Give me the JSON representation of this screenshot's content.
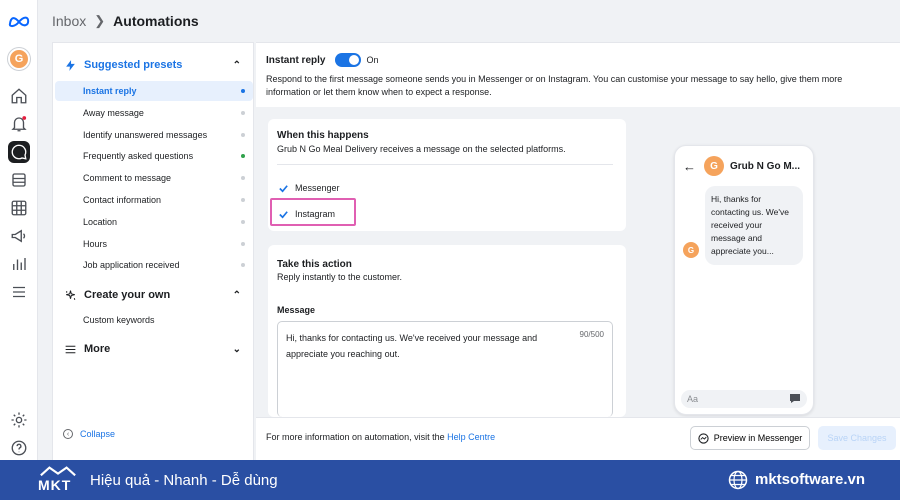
{
  "breadcrumb": {
    "parent": "Inbox",
    "current": "Automations"
  },
  "rail": {
    "avatar_letter": "G"
  },
  "sidebar": {
    "suggested_title": "Suggested presets",
    "suggested_items": [
      {
        "label": "Instant reply",
        "selected": true,
        "status": "blue"
      },
      {
        "label": "Away message",
        "status": "grey"
      },
      {
        "label": "Identify unanswered messages",
        "status": "grey"
      },
      {
        "label": "Frequently asked questions",
        "status": "green"
      },
      {
        "label": "Comment to message",
        "status": "grey"
      },
      {
        "label": "Contact information",
        "status": "grey"
      },
      {
        "label": "Location",
        "status": "grey"
      },
      {
        "label": "Hours",
        "status": "grey"
      },
      {
        "label": "Job application received",
        "status": "grey"
      }
    ],
    "create_title": "Create your own",
    "create_items": [
      {
        "label": "Custom keywords"
      }
    ],
    "more_title": "More",
    "collapse_label": "Collapse"
  },
  "main": {
    "title": "Instant reply",
    "toggle_label": "On",
    "description": "Respond to the first message someone sends you in Messenger or on Instagram. You can customise your message to say hello, give them more information or let them know when to expect a response.",
    "trigger": {
      "title": "When this happens",
      "subtitle": "Grub N Go Meal Delivery receives a message on the selected platforms.",
      "platforms": [
        {
          "label": "Messenger",
          "checked": true
        },
        {
          "label": "Instagram",
          "checked": true
        }
      ]
    },
    "action": {
      "title": "Take this action",
      "subtitle": "Reply instantly to the customer.",
      "message_label": "Message",
      "message_text": "Hi, thanks for contacting us. We've received your message and appreciate you reaching out.",
      "char_count": "90/500"
    }
  },
  "preview": {
    "page_name": "Grub N Go M...",
    "avatar_letter": "G",
    "bubble_text": "Hi, thanks for contacting us. We've received your message and appreciate you...",
    "input_placeholder": "Aa"
  },
  "footer": {
    "info_text": "For more information on automation, visit the",
    "help_link": "Help Centre",
    "preview_button": "Preview in Messenger",
    "save_button": "Save Changes"
  },
  "banner": {
    "logo_text": "MKT",
    "tagline": "Hiệu quả - Nhanh - Dễ dùng",
    "website": "mktsoftware.vn"
  }
}
